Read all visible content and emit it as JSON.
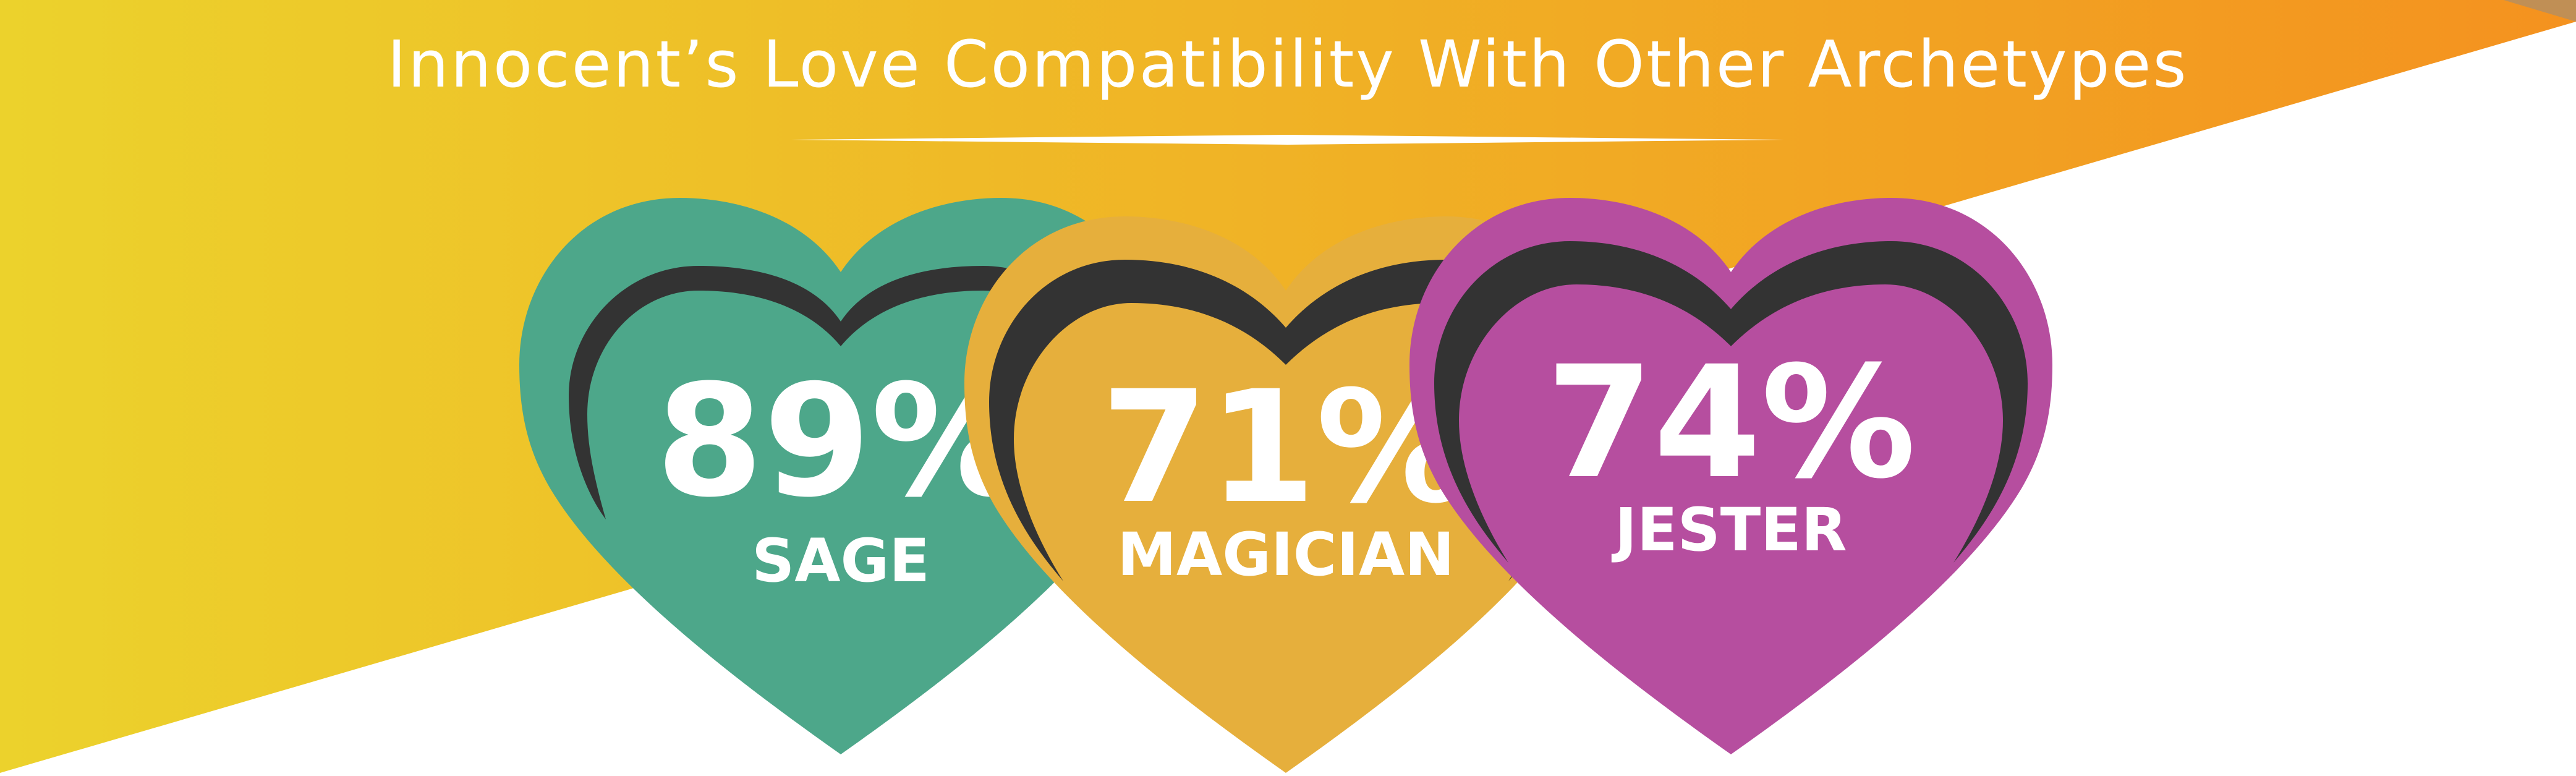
{
  "title": "Innocent’s Love Compatibility With Other Archetypes",
  "colors": {
    "background_gradient_start": "#ECD22C",
    "background_gradient_end": "#F4921F",
    "sage": "#4DA78A",
    "magician": "#E6AF3C",
    "jester": "#B64E9F",
    "shadow": "#333333",
    "text": "#FFFFFF"
  },
  "hearts": [
    {
      "percent": "89%",
      "name": "SAGE",
      "value": 89,
      "color": "#4DA78A"
    },
    {
      "percent": "71%",
      "name": "MAGICIAN",
      "value": 71,
      "color": "#E6AF3C"
    },
    {
      "percent": "74%",
      "name": "JESTER",
      "value": 74,
      "color": "#B64E9F"
    }
  ]
}
